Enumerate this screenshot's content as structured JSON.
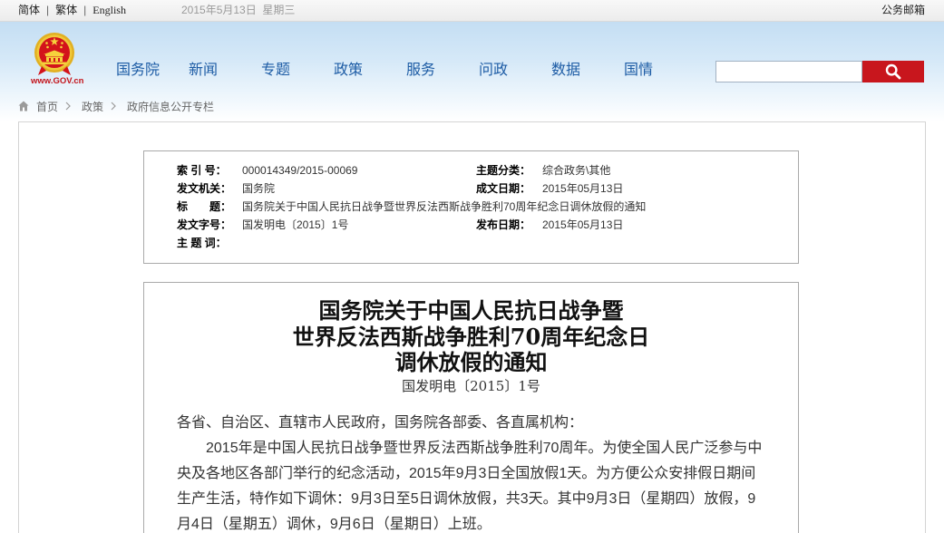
{
  "topbar": {
    "languages": [
      "简体",
      "繁体",
      "English"
    ],
    "separator": "|",
    "date": "2015年5月13日  星期三",
    "mailbox": "公务邮箱"
  },
  "header": {
    "logo_text": "www.GOV.cn",
    "nav": [
      "国务院",
      "新闻",
      "专题",
      "政策",
      "服务",
      "问政",
      "数据",
      "国情"
    ],
    "search_icon": "search-icon"
  },
  "breadcrumb": {
    "home_icon": "home-icon",
    "items": [
      "首页",
      "政策",
      "政府信息公开专栏"
    ]
  },
  "info": {
    "index_no": {
      "label": "索 引 号：",
      "value": "000014349/2015-00069"
    },
    "category": {
      "label": "主题分类：",
      "value": "综合政务\\其他"
    },
    "issuer": {
      "label": "发文机关：",
      "value": "国务院"
    },
    "written_date": {
      "label": "成文日期：",
      "value": "2015年05月13日"
    },
    "title": {
      "label": "标　　题：",
      "value": "国务院关于中国人民抗日战争暨世界反法西斯战争胜利70周年纪念日调休放假的通知"
    },
    "doc_no": {
      "label": "发文字号：",
      "value": "国发明电〔2015〕1号"
    },
    "publish_date": {
      "label": "发布日期：",
      "value": "2015年05月13日"
    },
    "keywords": {
      "label": "主 题 词："
    }
  },
  "article": {
    "title_lines": [
      "国务院关于中国人民抗日战争暨",
      "世界反法西斯战争胜利70周年纪念日",
      "调休放假的通知"
    ],
    "doc_no": "国发明电〔2015〕1号",
    "salutation": "各省、自治区、直辖市人民政府，国务院各部委、各直属机构：",
    "paragraphs": [
      "2015年是中国人民抗日战争暨世界反法西斯战争胜利70周年。为使全国人民广泛参与中央及各地区各部门举行的纪念活动，2015年9月3日全国放假1天。为方便公众安排假日期间生产生活，特作如下调休：9月3日至5日调休放假，共3天。其中9月3日（星期四）放假，9月4日（星期五）调休，9月6日（星期日）上班。"
    ]
  },
  "colors": {
    "nav_text": "#1d5ca5",
    "search_button": "#c8161d",
    "logo_text": "#c4151c"
  }
}
